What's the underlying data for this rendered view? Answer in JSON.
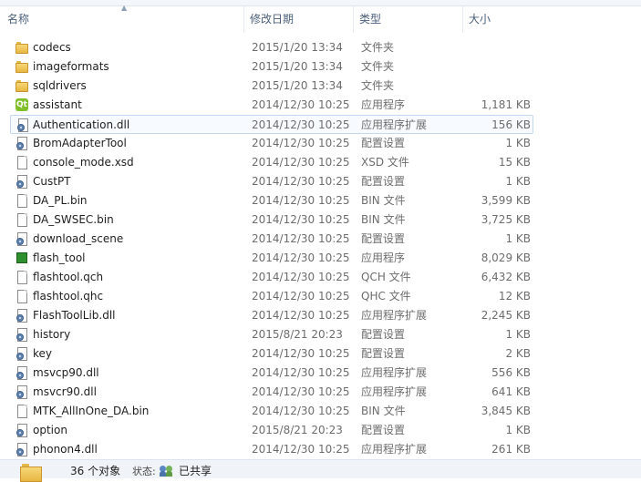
{
  "columns": {
    "name": "名称",
    "date": "修改日期",
    "type": "类型",
    "size": "大小"
  },
  "files": [
    {
      "name": "codecs",
      "date": "2015/1/20 13:34",
      "type": "文件夹",
      "size": "",
      "icon": "folder-icon"
    },
    {
      "name": "imageformats",
      "date": "2015/1/20 13:34",
      "type": "文件夹",
      "size": "",
      "icon": "folder-icon"
    },
    {
      "name": "sqldrivers",
      "date": "2015/1/20 13:34",
      "type": "文件夹",
      "size": "",
      "icon": "folder-icon"
    },
    {
      "name": "assistant",
      "date": "2014/12/30 10:25",
      "type": "应用程序",
      "size": "1,181 KB",
      "icon": "qt-app-icon"
    },
    {
      "name": "Authentication.dll",
      "date": "2014/12/30 10:25",
      "type": "应用程序扩展",
      "size": "156 KB",
      "icon": "dll-icon",
      "selected": true
    },
    {
      "name": "BromAdapterTool",
      "date": "2014/12/30 10:25",
      "type": "配置设置",
      "size": "1 KB",
      "icon": "config-icon"
    },
    {
      "name": "console_mode.xsd",
      "date": "2014/12/30 10:25",
      "type": "XSD 文件",
      "size": "15 KB",
      "icon": "file-icon"
    },
    {
      "name": "CustPT",
      "date": "2014/12/30 10:25",
      "type": "配置设置",
      "size": "1 KB",
      "icon": "config-icon"
    },
    {
      "name": "DA_PL.bin",
      "date": "2014/12/30 10:25",
      "type": "BIN 文件",
      "size": "3,599 KB",
      "icon": "file-icon"
    },
    {
      "name": "DA_SWSEC.bin",
      "date": "2014/12/30 10:25",
      "type": "BIN 文件",
      "size": "3,725 KB",
      "icon": "file-icon"
    },
    {
      "name": "download_scene",
      "date": "2014/12/30 10:25",
      "type": "配置设置",
      "size": "1 KB",
      "icon": "config-icon"
    },
    {
      "name": "flash_tool",
      "date": "2014/12/30 10:25",
      "type": "应用程序",
      "size": "8,029 KB",
      "icon": "flash-app-icon"
    },
    {
      "name": "flashtool.qch",
      "date": "2014/12/30 10:25",
      "type": "QCH 文件",
      "size": "6,432 KB",
      "icon": "file-icon"
    },
    {
      "name": "flashtool.qhc",
      "date": "2014/12/30 10:25",
      "type": "QHC 文件",
      "size": "12 KB",
      "icon": "file-icon"
    },
    {
      "name": "FlashToolLib.dll",
      "date": "2014/12/30 10:25",
      "type": "应用程序扩展",
      "size": "2,245 KB",
      "icon": "dll-icon"
    },
    {
      "name": "history",
      "date": "2015/8/21 20:23",
      "type": "配置设置",
      "size": "1 KB",
      "icon": "config-icon"
    },
    {
      "name": "key",
      "date": "2014/12/30 10:25",
      "type": "配置设置",
      "size": "2 KB",
      "icon": "config-icon"
    },
    {
      "name": "msvcp90.dll",
      "date": "2014/12/30 10:25",
      "type": "应用程序扩展",
      "size": "556 KB",
      "icon": "dll-icon"
    },
    {
      "name": "msvcr90.dll",
      "date": "2014/12/30 10:25",
      "type": "应用程序扩展",
      "size": "641 KB",
      "icon": "dll-icon"
    },
    {
      "name": "MTK_AllInOne_DA.bin",
      "date": "2014/12/30 10:25",
      "type": "BIN 文件",
      "size": "3,845 KB",
      "icon": "file-icon"
    },
    {
      "name": "option",
      "date": "2015/8/21 20:23",
      "type": "配置设置",
      "size": "1 KB",
      "icon": "config-icon"
    },
    {
      "name": "phonon4.dll",
      "date": "2014/12/30 10:25",
      "type": "应用程序扩展",
      "size": "261 KB",
      "icon": "dll-icon"
    }
  ],
  "status": {
    "count": "36 个对象",
    "state_label": "状态:",
    "share": "已共享"
  }
}
